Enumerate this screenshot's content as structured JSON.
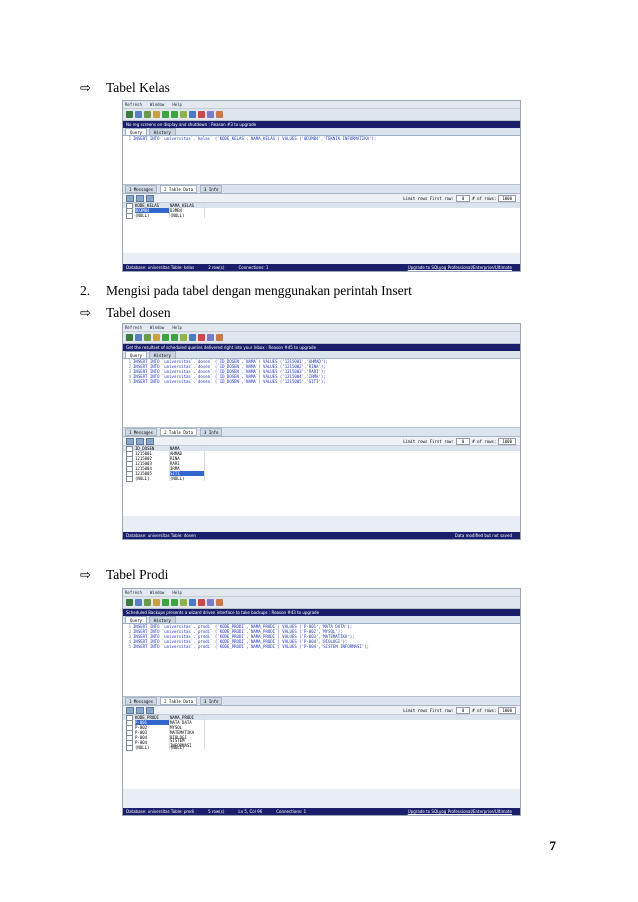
{
  "page": {
    "heading_kelas": "Tabel Kelas",
    "item2_number": "2.",
    "item2_text": "Mengisi pada tabel dengan menggunakan perintah Insert",
    "heading_dosen": "Tabel dosen",
    "heading_prodi": "Tabel Prodi",
    "page_number": "7",
    "arrow_glyph": "⇨"
  },
  "shot_common": {
    "menu": [
      "Refresh",
      "Window",
      "Help"
    ],
    "query_tab": "Query",
    "history_tab": "History",
    "messages_tab": "1 Messages",
    "tabledata_tab": "2 Table Data",
    "info_tab": "3 Info",
    "limit_label": "Limit rows  First row:",
    "first_row": "0",
    "rows_label": "# of rows:",
    "rows_value": "1000",
    "upgrade": "Upgrade to SQLyog Professional/Enterprise/Ultimate"
  },
  "shot_kelas": {
    "banner": "No reg screens on display and shutdown : Reason #3 to upgrade",
    "code": [
      {
        "n": "1",
        "text": "INSERT INTO `universitas`.`kelas` (`KODE_KELAS`,`NAMA_KELAS`) VALUES ('0D3MB4','TEKNIK INFORMATIKA');"
      }
    ],
    "columns": [
      "KODE_KELAS",
      "NAMA_KELAS"
    ],
    "rows": [
      [
        "0D3MB4",
        "D3MB4"
      ],
      [
        "(NULL)",
        "(NULL)"
      ]
    ],
    "status_db": "Database: universitas   Table: kelas",
    "status_rows": "2 row(s)",
    "status_conn": "Connections: 1"
  },
  "shot_dosen": {
    "banner": "Get the resultset of scheduled queries delivered right into your Inbox : Reason #45 to upgrade",
    "code": [
      {
        "n": "1",
        "text": "INSERT INTO `universitas`.`dosen` (`ID_DOSEN`,`NAMA`) VALUES ('1215001','AHMAD');"
      },
      {
        "n": "2",
        "text": "INSERT INTO `universitas`.`dosen` (`ID_DOSEN`,`NAMA`) VALUES ('1215002','RINA');"
      },
      {
        "n": "3",
        "text": "INSERT INTO `universitas`.`dosen` (`ID_DOSEN`,`NAMA`) VALUES ('1215003','RARI');"
      },
      {
        "n": "4",
        "text": "INSERT INTO `universitas`.`dosen` (`ID_DOSEN`,`NAMA`) VALUES ('1215004','IRMA');"
      },
      {
        "n": "5",
        "text": "INSERT INTO `universitas`.`dosen` (`ID_DOSEN`,`NAMA`) VALUES ('1215005','SITI');"
      }
    ],
    "columns": [
      "ID_DOSEN",
      "NAMA"
    ],
    "rows": [
      [
        "1215001",
        "AHMAD"
      ],
      [
        "1215002",
        "RINA"
      ],
      [
        "1215003",
        "RARI"
      ],
      [
        "1215004",
        "IRMA"
      ],
      [
        "1215005",
        "SITI"
      ],
      [
        "(NULL)",
        "(NULL)"
      ]
    ],
    "status_db": "Database: universitas   Table: dosen",
    "status_right": "Data modified but not saved"
  },
  "shot_prodi": {
    "banner": "Scheduled Backups presents a wizard driven interface to take backups : Reason #43 to upgrade",
    "code": [
      {
        "n": "1",
        "text": "INSERT INTO `universitas`.`prodi` (`KODE_PRODI`,`NAMA_PRODI`) VALUES ('P-001','MATA DATA');"
      },
      {
        "n": "2",
        "text": "INSERT INTO `universitas`.`prodi` (`KODE_PRODI`,`NAMA_PRODI`) VALUES ('P-002','MYSQL');"
      },
      {
        "n": "3",
        "text": "INSERT INTO `universitas`.`prodi` (`KODE_PRODI`,`NAMA_PRODI`) VALUES ('P-003','MATEMATIKA');"
      },
      {
        "n": "4",
        "text": "INSERT INTO `universitas`.`prodi` (`KODE_PRODI`,`NAMA_PRODI`) VALUES ('P-004','BIOLOGI');"
      },
      {
        "n": "5",
        "text": "INSERT INTO `universitas`.`prodi` (`KODE_PRODI`,`NAMA_PRODI`) VALUES ('P-004','SISTEM INFORMASI');"
      }
    ],
    "columns": [
      "KODE_PRODI",
      "NAMA_PRODI"
    ],
    "rows": [
      [
        "P-001",
        "MATA DATA"
      ],
      [
        "P-002",
        "MYSQL"
      ],
      [
        "P-003",
        "MATEMATIKA"
      ],
      [
        "P-004",
        "BIOLOGI"
      ],
      [
        "P-004",
        "SISTEM INFORMASI"
      ],
      [
        "(NULL)",
        "(NULL)"
      ]
    ],
    "status_db": "Database: universitas   Table: prodi",
    "status_rows": "5 row(s)",
    "status_pos": "Ln 5, Col 96",
    "status_conn": "Connections: 1"
  }
}
